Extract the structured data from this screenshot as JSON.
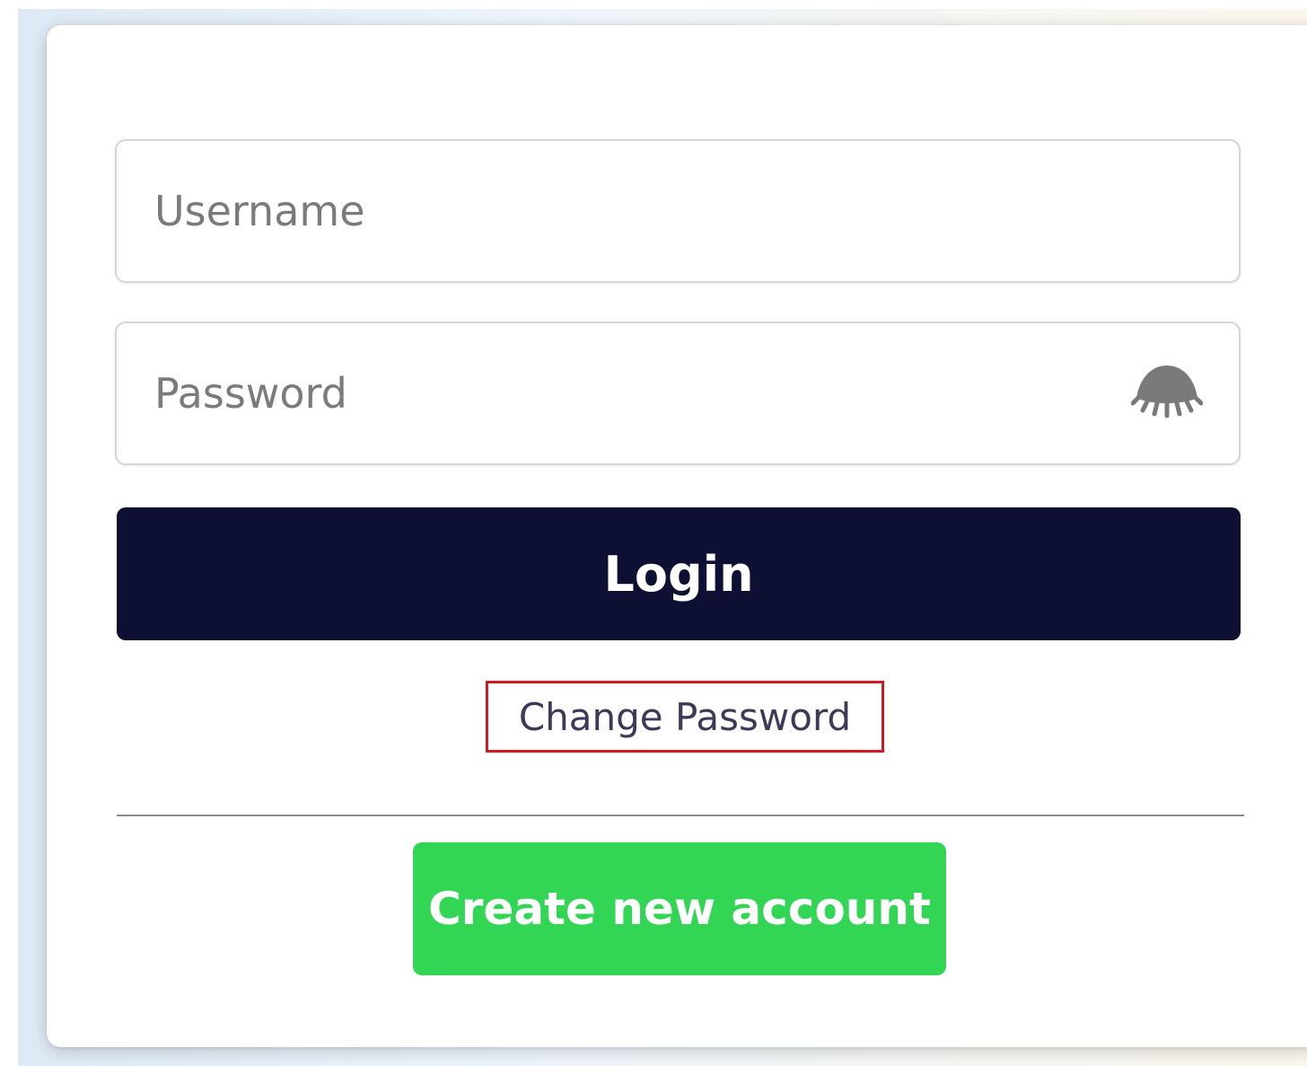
{
  "login_form": {
    "username": {
      "placeholder": "Username",
      "value": ""
    },
    "password": {
      "placeholder": "Password",
      "value": "",
      "toggle_icon": "eye-hidden-icon"
    },
    "login_button_label": "Login",
    "change_password_label": "Change Password",
    "create_account_label": "Create new account"
  },
  "colors": {
    "login_button": "#0e1033",
    "create_account_button": "#33d555",
    "highlight_border": "#d11a22",
    "link_text": "#3c3a58"
  }
}
